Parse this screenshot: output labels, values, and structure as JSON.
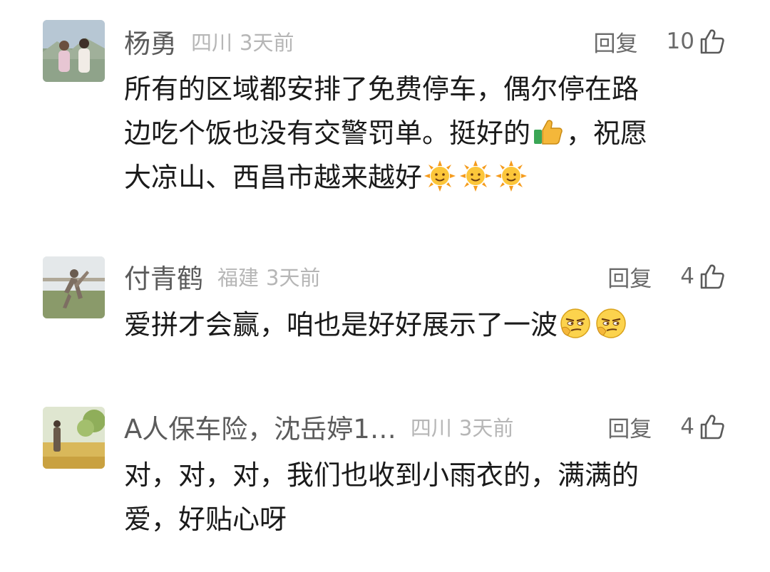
{
  "comments": [
    {
      "username": "杨勇",
      "location": "四川",
      "time": "3天前",
      "reply_label": "回复",
      "likes": "10",
      "lines": [
        "所有的区域都安排了免费停车，偶尔停在路",
        "边吃个饭也没有交警罚单。挺好的",
        "，祝愿",
        "大凉山、西昌市越来越好"
      ],
      "emojis": [
        "thumbs-up-emoji",
        "sun-emoji",
        "sun-emoji",
        "sun-emoji"
      ]
    },
    {
      "username": "付青鹤",
      "location": "福建",
      "time": "3天前",
      "reply_label": "回复",
      "likes": "4",
      "lines": [
        "爱拼才会赢，咱也是好好展示了一波"
      ],
      "emojis": [
        "smirk-face-emoji",
        "smirk-face-emoji"
      ]
    },
    {
      "username": "A人保车险，沈岳婷1…",
      "location": "四川",
      "time": "3天前",
      "reply_label": "回复",
      "likes": "4",
      "lines": [
        "对，对，对，我们也收到小雨衣的，满满的",
        "爱，好贴心呀"
      ],
      "emojis": []
    }
  ],
  "colors": {
    "username": "#5b5b5b",
    "meta": "#b6b6b6",
    "body_text": "#1a1a1a",
    "action": "#6a6a6a"
  },
  "icons": {
    "like": "thumbs-up-outline-icon"
  }
}
